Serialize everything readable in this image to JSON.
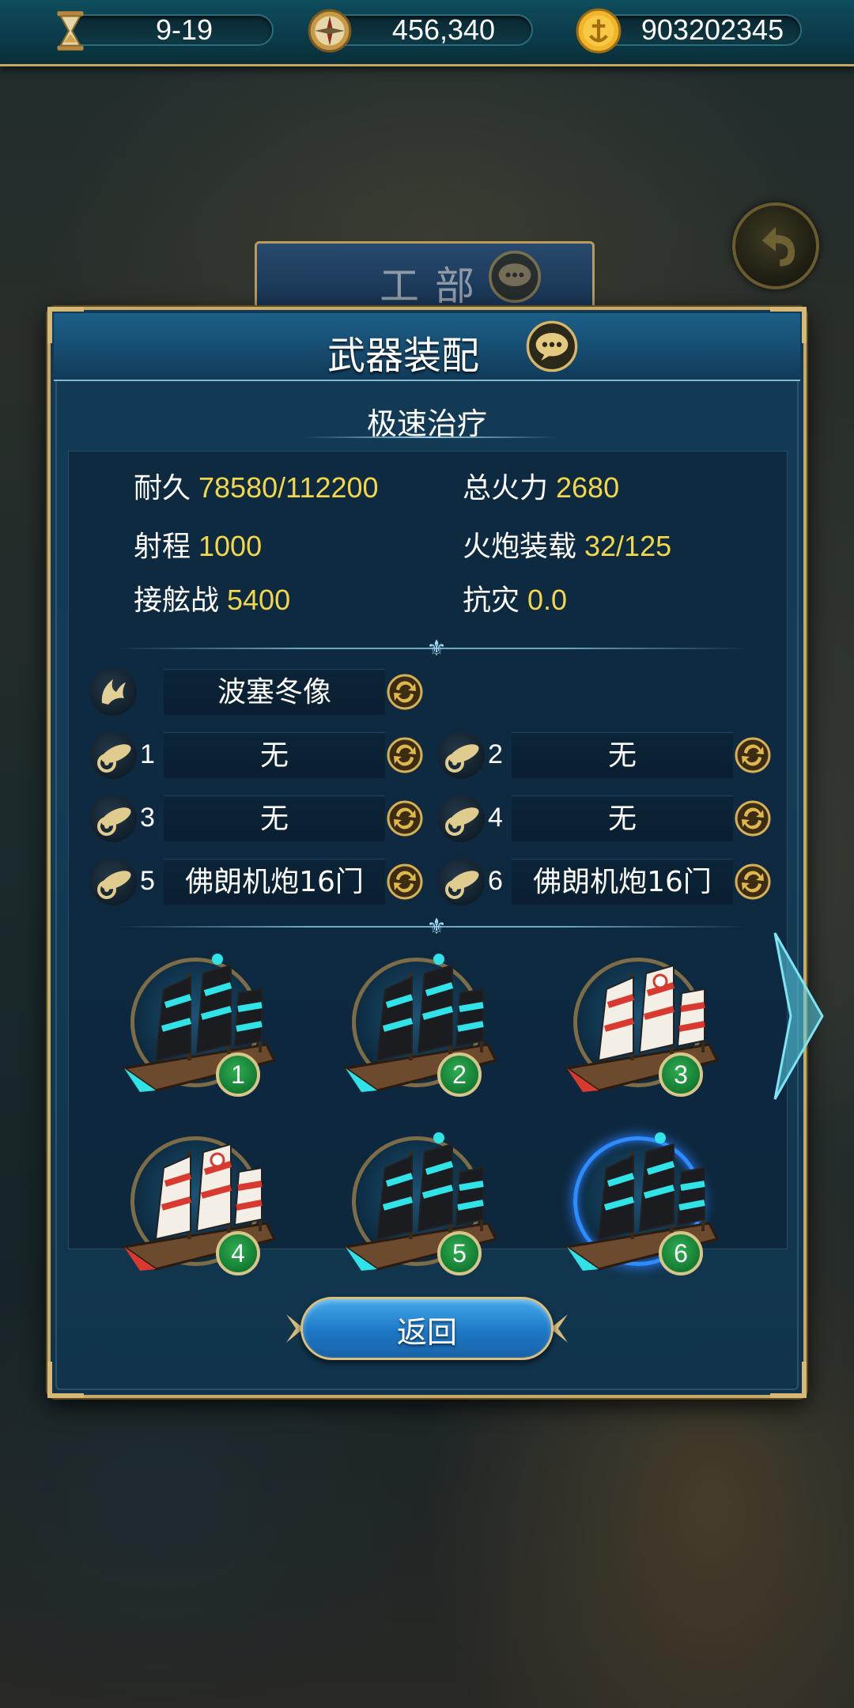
{
  "topbar": {
    "time": {
      "icon": "hourglass-icon",
      "value": "9-19"
    },
    "compass": {
      "icon": "compass-icon",
      "value": "456,340"
    },
    "gold": {
      "icon": "gold-coin-icon",
      "value": "903202345"
    }
  },
  "background": {
    "building_title": "工部",
    "back_icon": "back-arrow-icon"
  },
  "dialog": {
    "title": "武器装配",
    "ship_name": "极速治疗",
    "stats": {
      "durability_label": "耐久",
      "durability_value": "78580/112200",
      "firepower_label": "总火力",
      "firepower_value": "2680",
      "range_label": "射程",
      "range_value": "1000",
      "cannon_load_label": "火炮装载",
      "cannon_load_value": "32/125",
      "boarding_label": "接舷战",
      "boarding_value": "5400",
      "disaster_label": "抗灾",
      "disaster_value": "0.0"
    },
    "figurehead": {
      "icon": "wing-icon",
      "value": "波塞冬像"
    },
    "cannons": [
      {
        "num": "1",
        "value": "无"
      },
      {
        "num": "2",
        "value": "无"
      },
      {
        "num": "3",
        "value": "无"
      },
      {
        "num": "4",
        "value": "无"
      },
      {
        "num": "5",
        "value": "佛朗机炮16门"
      },
      {
        "num": "6",
        "value": "佛朗机炮16门"
      }
    ],
    "ships": [
      {
        "badge": "1",
        "style": "teal"
      },
      {
        "badge": "2",
        "style": "teal"
      },
      {
        "badge": "3",
        "style": "red"
      },
      {
        "badge": "4",
        "style": "red"
      },
      {
        "badge": "5",
        "style": "teal"
      },
      {
        "badge": "6",
        "style": "teal"
      }
    ],
    "selected_ship": "6",
    "return_label": "返回"
  },
  "colors": {
    "accent_gold": "#c8aa68",
    "value_yellow": "#f3d64a",
    "panel_blue": "#143a55",
    "badge_green": "#1e8c3e"
  }
}
